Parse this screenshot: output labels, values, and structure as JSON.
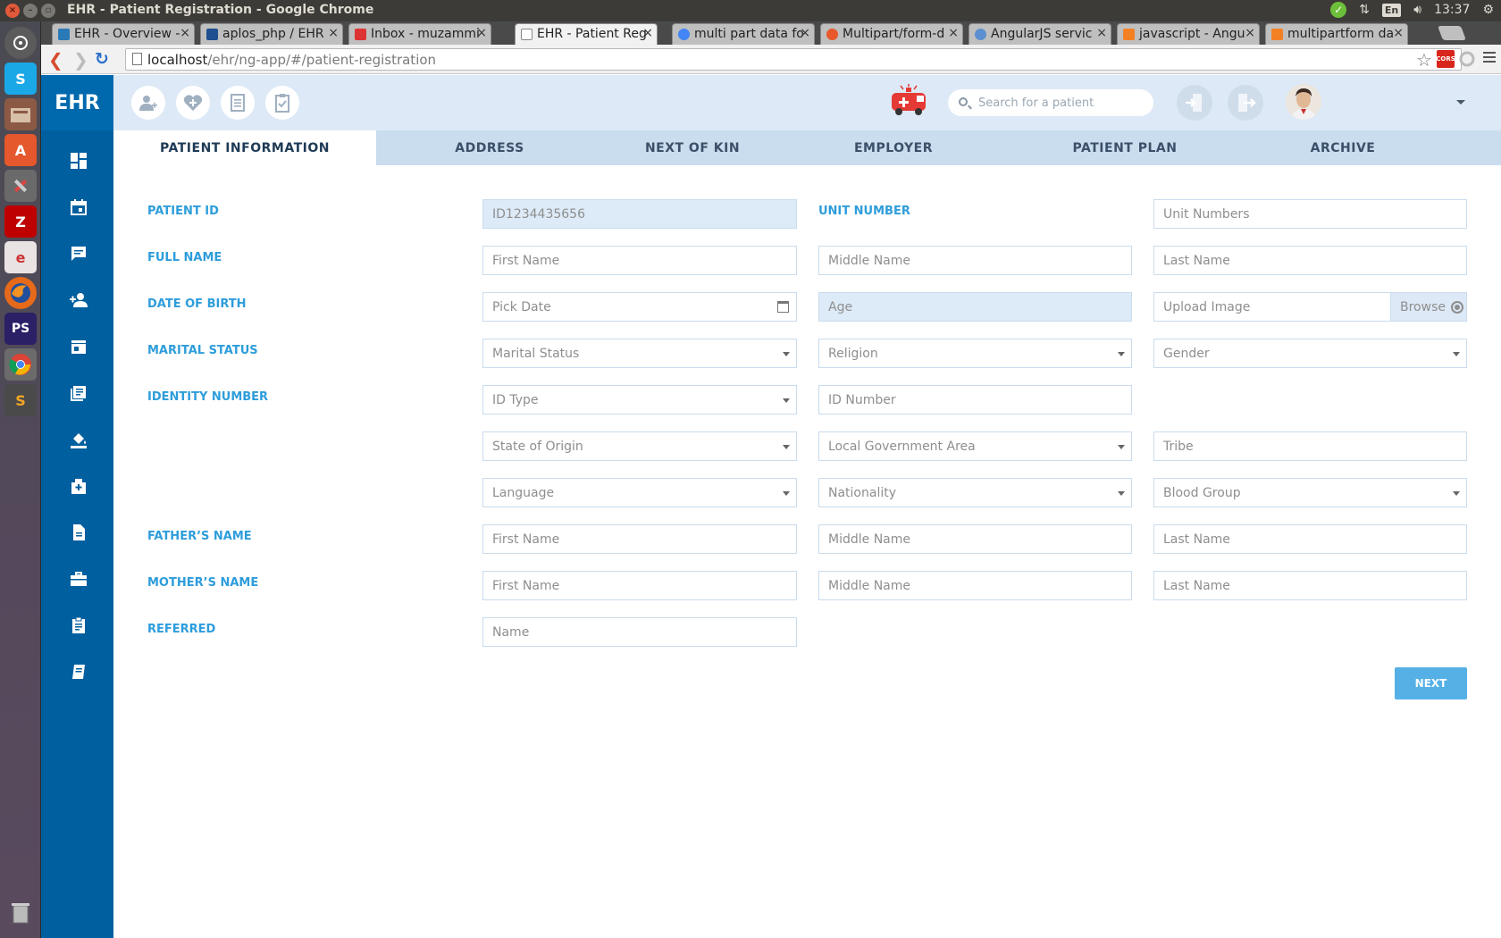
{
  "os": {
    "window_title": "EHR - Patient Registration - Google Chrome",
    "time": "13:37",
    "lang": "En"
  },
  "browser": {
    "tabs": [
      {
        "label": "EHR - Overview -"
      },
      {
        "label": "aplos_php / EHR"
      },
      {
        "label": "Inbox - muzammi"
      },
      {
        "label": "EHR - Patient Reg"
      },
      {
        "label": "multi part data fo"
      },
      {
        "label": "Multipart/form-d"
      },
      {
        "label": "AngularJS servic"
      },
      {
        "label": "javascript - Angu"
      },
      {
        "label": "multipartform da"
      }
    ],
    "url_host": "localhost",
    "url_path": "/ehr/ng-app/#/patient-registration",
    "cors_label": "CORS"
  },
  "app": {
    "brand": "EHR",
    "search_placeholder": "Search for a patient"
  },
  "tabs": [
    {
      "label": "PATIENT INFORMATION"
    },
    {
      "label": "ADDRESS"
    },
    {
      "label": "NEXT OF KIN"
    },
    {
      "label": "EMPLOYER"
    },
    {
      "label": "PATIENT PLAN"
    },
    {
      "label": "ARCHIVE"
    }
  ],
  "form": {
    "labels": {
      "patient_id": "PATIENT ID",
      "unit_number": "UNIT NUMBER",
      "full_name": "FULL NAME",
      "dob": "DATE OF BIRTH",
      "marital": "MARITAL STATUS",
      "identity": "IDENTITY NUMBER",
      "father": "FATHER’S NAME",
      "mother": "MOTHER’S NAME",
      "referred": "REFERRED"
    },
    "patient_id_value": "ID1234435656",
    "unit_numbers": "Unit Numbers",
    "first_name": "First Name",
    "middle_name": "Middle Name",
    "last_name": "Last Name",
    "pick_date": "Pick Date",
    "age": "Age",
    "upload_image": "Upload Image",
    "browse": "Browse",
    "marital_status": "Marital Status",
    "religion": "Religion",
    "gender": "Gender",
    "id_type": "ID Type",
    "id_number": "ID Number",
    "state_of_origin": "State of Origin",
    "lga": "Local Government Area",
    "tribe": "Tribe",
    "language": "Language",
    "nationality": "Nationality",
    "blood_group": "Blood Group",
    "name": "Name",
    "next": "NEXT"
  }
}
